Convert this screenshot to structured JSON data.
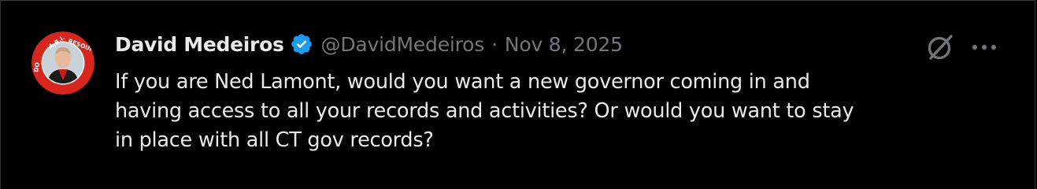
{
  "tweet": {
    "author": {
      "display_name": "David Medeiros",
      "handle": "@DavidMedeiros",
      "verified": true,
      "avatar_icon": "avatar-photo-with-red-badge-ring",
      "avatar_ring_text": "A.B.I. RESOURCES"
    },
    "separator": "·",
    "timestamp": "Nov 8, 2025",
    "text": "If you are Ned Lamont, would you want a new governor coming in and\nhaving access to all your records and activities? Or would you want to stay\nin place with all CT gov records?",
    "actions": {
      "grok_icon": "grok-icon",
      "more_icon": "more-icon"
    }
  },
  "colors": {
    "background": "#000000",
    "primary_text": "#e7e9ea",
    "secondary_text": "#71767b",
    "verified_blue": "#1d9bf0",
    "border": "#2f3336"
  }
}
